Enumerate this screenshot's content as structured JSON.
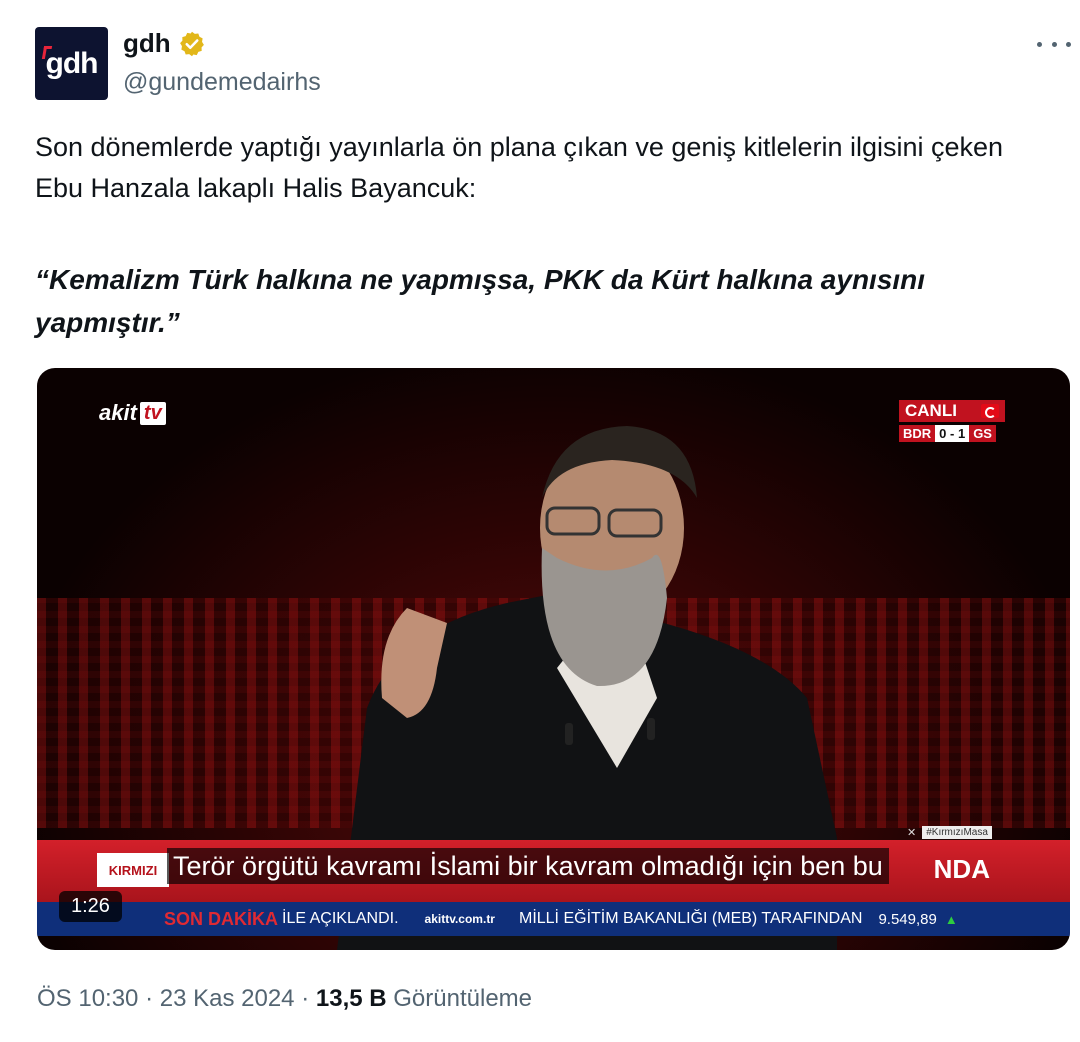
{
  "author": {
    "avatar_text": "gdh",
    "name": "gdh",
    "handle": "@gundemedairhs",
    "verified": true
  },
  "tweet": {
    "text": "Son dönemlerde yaptığı yayınlarla ön plana çıkan ve geniş kitlelerin ilgisini çeken Ebu Hanzala lakaplı Halis Bayancuk:",
    "quote": "“Kemalizm Türk halkına ne yapmışsa, PKK da Kürt halkına aynısını yapmıştır.”"
  },
  "video": {
    "channel": "akit",
    "channel_tv": "tv",
    "live_label": "CANLI",
    "score_home": "BDR",
    "score": "0 - 1",
    "score_away": "GS",
    "hashtag": "#KırmızıMasa",
    "lower_third_label": "KIRMIZI",
    "lower_third_suffix": "NDA",
    "subtitle": "Terör örgütü kavramı İslami bir kavram olmadığı için ben bu",
    "ticker_son": "SON DAKİKA",
    "ticker_text1": "İLE AÇIKLANDI.",
    "ticker_site": "akittv.com.tr",
    "ticker_text2": "MİLLİ EĞİTİM BAKANLIĞI (MEB) TARAFINDAN",
    "ticker_index": "9.549,89",
    "duration": "1:26"
  },
  "meta": {
    "time": "ÖS 10:30",
    "sep1": "·",
    "date": "23 Kas 2024",
    "sep2": "·",
    "views": "13,5 B",
    "views_label": "Görüntüleme"
  },
  "colors": {
    "brand_red": "#c1121f",
    "text": "#0f1419",
    "muted": "#536471",
    "ticker_blue": "#0f2f7a",
    "verified_gold": "#e2b719"
  }
}
